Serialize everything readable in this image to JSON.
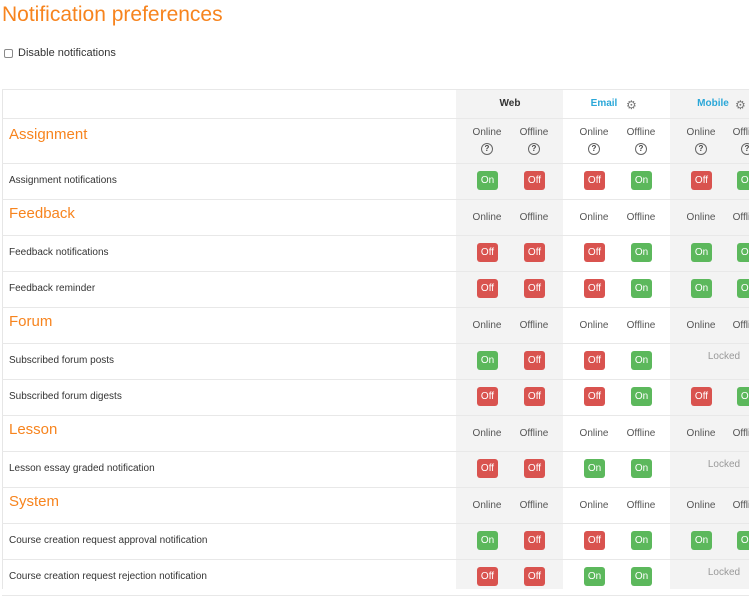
{
  "page": {
    "title": "Notification preferences",
    "disable_label": "Disable notifications"
  },
  "processors": [
    {
      "name": "Web",
      "has_settings": false
    },
    {
      "name": "Email",
      "has_settings": true
    },
    {
      "name": "Mobile",
      "has_settings": true
    }
  ],
  "state_labels": {
    "online": "Online",
    "offline": "Offline",
    "on": "On",
    "off": "Off",
    "locked": "Locked",
    "help": "?"
  },
  "sections": [
    {
      "title": "Assignment",
      "help": true,
      "items": [
        {
          "label": "Assignment notifications",
          "states": [
            "on",
            "off",
            "off",
            "on",
            "off",
            "on"
          ]
        }
      ]
    },
    {
      "title": "Feedback",
      "help": false,
      "items": [
        {
          "label": "Feedback notifications",
          "states": [
            "off",
            "off",
            "off",
            "on",
            "on",
            "on"
          ]
        },
        {
          "label": "Feedback reminder",
          "states": [
            "off",
            "off",
            "off",
            "on",
            "on",
            "on"
          ]
        }
      ]
    },
    {
      "title": "Forum",
      "help": false,
      "items": [
        {
          "label": "Subscribed forum posts",
          "states": [
            "on",
            "off",
            "off",
            "on",
            "locked",
            "locked"
          ]
        },
        {
          "label": "Subscribed forum digests",
          "states": [
            "off",
            "off",
            "off",
            "on",
            "off",
            "on"
          ]
        }
      ]
    },
    {
      "title": "Lesson",
      "help": false,
      "items": [
        {
          "label": "Lesson essay graded notification",
          "states": [
            "off",
            "off",
            "on",
            "on",
            "locked",
            "locked"
          ]
        }
      ]
    },
    {
      "title": "System",
      "help": false,
      "items": [
        {
          "label": "Course creation request approval notification",
          "states": [
            "on",
            "off",
            "off",
            "on",
            "on",
            "on"
          ]
        },
        {
          "label": "Course creation request rejection notification",
          "states": [
            "off",
            "off",
            "on",
            "on",
            "locked",
            "locked"
          ]
        }
      ]
    }
  ],
  "colors": {
    "accent": "#f7841e",
    "link": "#2aa7d8",
    "on": "#5cb85c",
    "off": "#d9534f"
  }
}
